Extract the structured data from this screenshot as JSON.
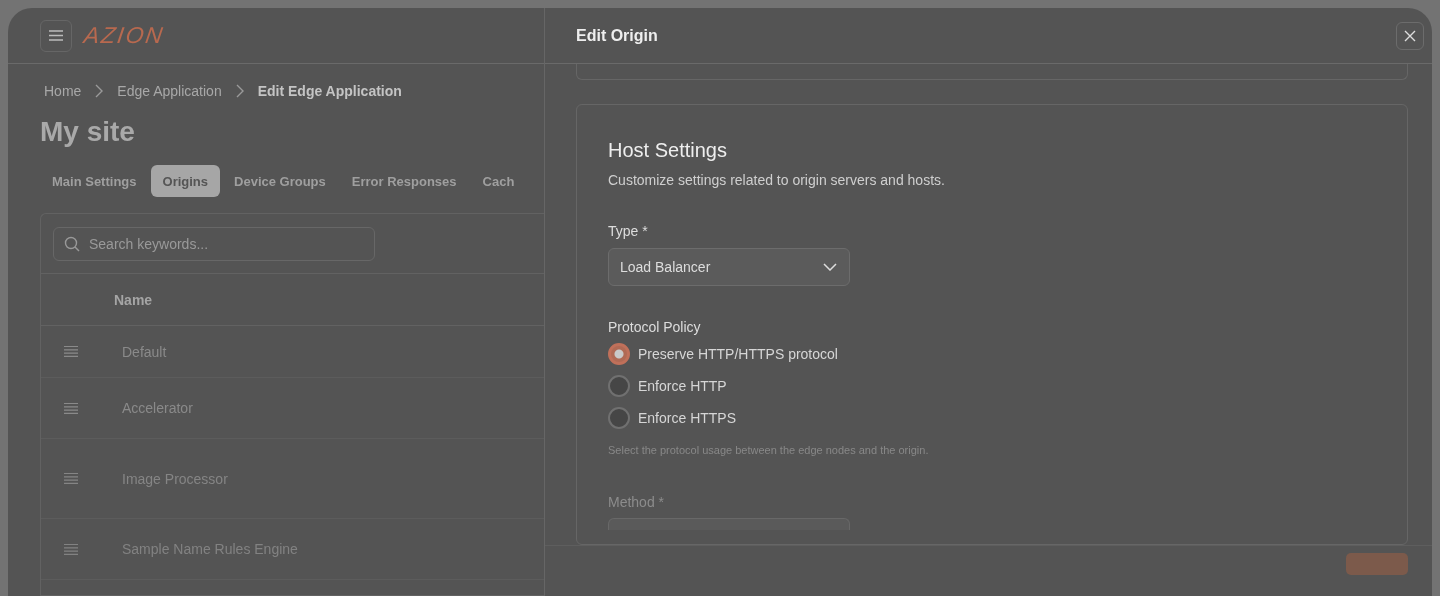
{
  "header": {
    "logo": "AZION"
  },
  "breadcrumb": [
    {
      "label": "Home",
      "current": false
    },
    {
      "label": "Edge Application",
      "current": false
    },
    {
      "label": "Edit Edge Application",
      "current": true
    }
  ],
  "page_title": "My site",
  "tabs": [
    {
      "label": "Main Settings",
      "selected": false
    },
    {
      "label": "Origins",
      "selected": true
    },
    {
      "label": "Device Groups",
      "selected": false
    },
    {
      "label": "Error Responses",
      "selected": false
    },
    {
      "label": "Cach",
      "selected": false
    }
  ],
  "table": {
    "search": {
      "placeholder": "Search keywords..."
    },
    "columns": [
      "Name"
    ],
    "rows": [
      {
        "name": "Default"
      },
      {
        "name": "Accelerator"
      },
      {
        "name": "Image Processor"
      },
      {
        "name": "Sample Name Rules Engine"
      }
    ]
  },
  "drawer": {
    "title": "Edit Origin",
    "host_settings": {
      "title": "Host Settings",
      "description": "Customize settings related to origin servers and hosts.",
      "type": {
        "label": "Type *",
        "value": "Load Balancer"
      },
      "protocol_policy": {
        "label": "Protocol Policy",
        "options": [
          {
            "label": "Preserve HTTP/HTTPS protocol",
            "selected": true
          },
          {
            "label": "Enforce HTTP",
            "selected": false
          },
          {
            "label": "Enforce HTTPS",
            "selected": false
          }
        ],
        "hint": "Select the protocol usage between the edge nodes and the origin."
      },
      "method": {
        "label": "Method *"
      }
    }
  }
}
